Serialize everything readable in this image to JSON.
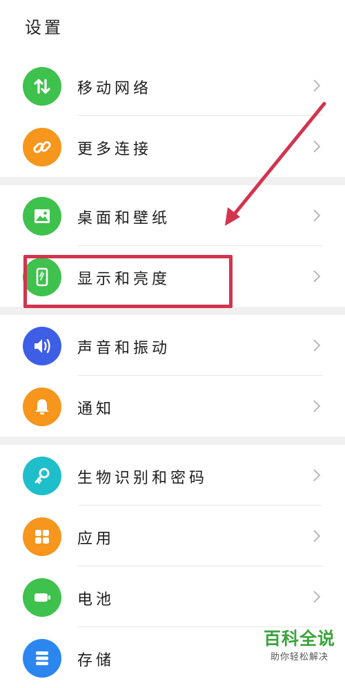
{
  "header": {
    "title": "设置"
  },
  "items": [
    {
      "label": "移动网络",
      "icon": "mobile-data-icon",
      "color": "#3fc14d"
    },
    {
      "label": "更多连接",
      "icon": "link-icon",
      "color": "#f6961d"
    },
    {
      "label": "桌面和壁纸",
      "icon": "image-icon",
      "color": "#3fc14d"
    },
    {
      "label": "显示和亮度",
      "icon": "display-brightness-icon",
      "color": "#3fc14d"
    },
    {
      "label": "声音和振动",
      "icon": "volume-icon",
      "color": "#3f5ee6"
    },
    {
      "label": "通知",
      "icon": "bell-icon",
      "color": "#f6961d"
    },
    {
      "label": "生物识别和密码",
      "icon": "key-icon",
      "color": "#1fbecb"
    },
    {
      "label": "应用",
      "icon": "apps-grid-icon",
      "color": "#f6961d"
    },
    {
      "label": "电池",
      "icon": "battery-icon",
      "color": "#3fc14d"
    },
    {
      "label": "存储",
      "icon": "storage-icon",
      "color": "#2c86f0"
    }
  ],
  "watermark": {
    "title": "百科全说",
    "subtitle": "助你轻松解决"
  },
  "annotation_color": "#d2344e"
}
